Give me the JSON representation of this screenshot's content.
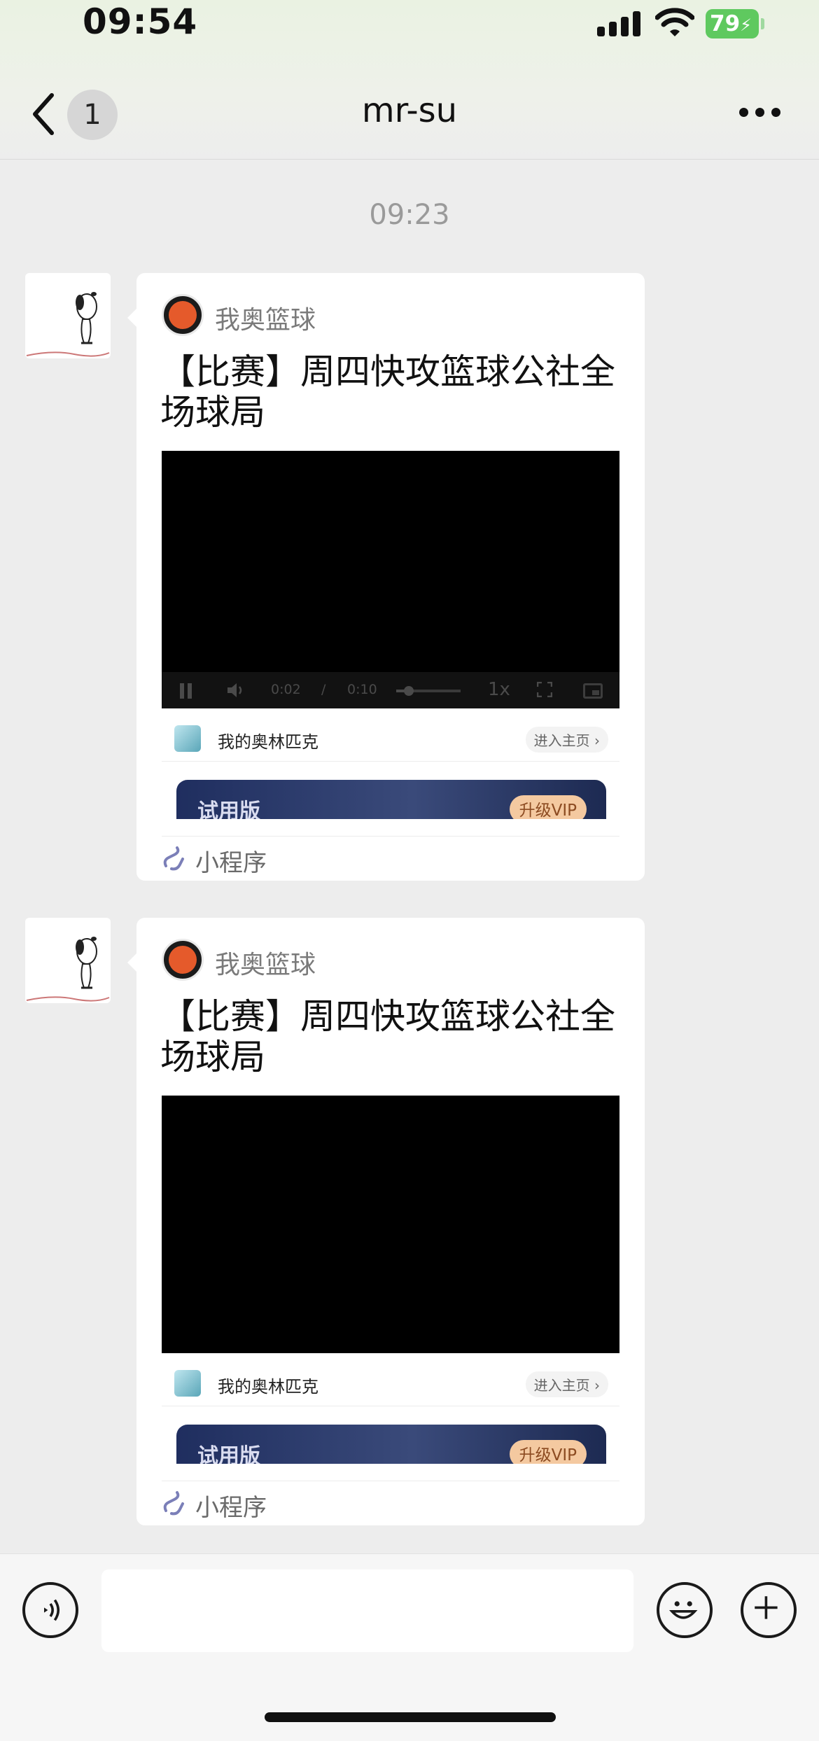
{
  "status": {
    "time": "09:54",
    "battery": "79"
  },
  "header": {
    "unread_badge": "1",
    "title": "mr-su"
  },
  "chat": {
    "timestamp": "09:23"
  },
  "messages": [
    {
      "source_name": "我奥篮球",
      "title": "【比赛】周四快攻篮球公社全场球局",
      "video": {
        "current_time": "0:02",
        "separator": "/",
        "duration": "0:10",
        "speed": "1x",
        "progress": 0.2
      },
      "account_name": "我的奥林匹克",
      "account_link": "进入主页 ›",
      "trial_label": "试用版",
      "vip_button": "升级VIP",
      "mini_program_label": "小程序"
    },
    {
      "source_name": "我奥篮球",
      "title": "【比赛】周四快攻篮球公社全场球局",
      "account_name": "我的奥林匹克",
      "account_link": "进入主页 ›",
      "trial_label": "试用版",
      "vip_button": "升级VIP",
      "mini_program_label": "小程序"
    }
  ],
  "icons": {
    "back": "chevron-left-icon",
    "more": "more-dots-icon",
    "voice": "voice-icon",
    "emoji": "emoji-icon",
    "plus": "plus-icon",
    "mini_program": "mini-program-link-icon"
  },
  "colors": {
    "background": "#ededed",
    "battery": "#5fc95f",
    "vip_button": "#f4c9a0",
    "vip_banner": "#1f2e5f"
  }
}
